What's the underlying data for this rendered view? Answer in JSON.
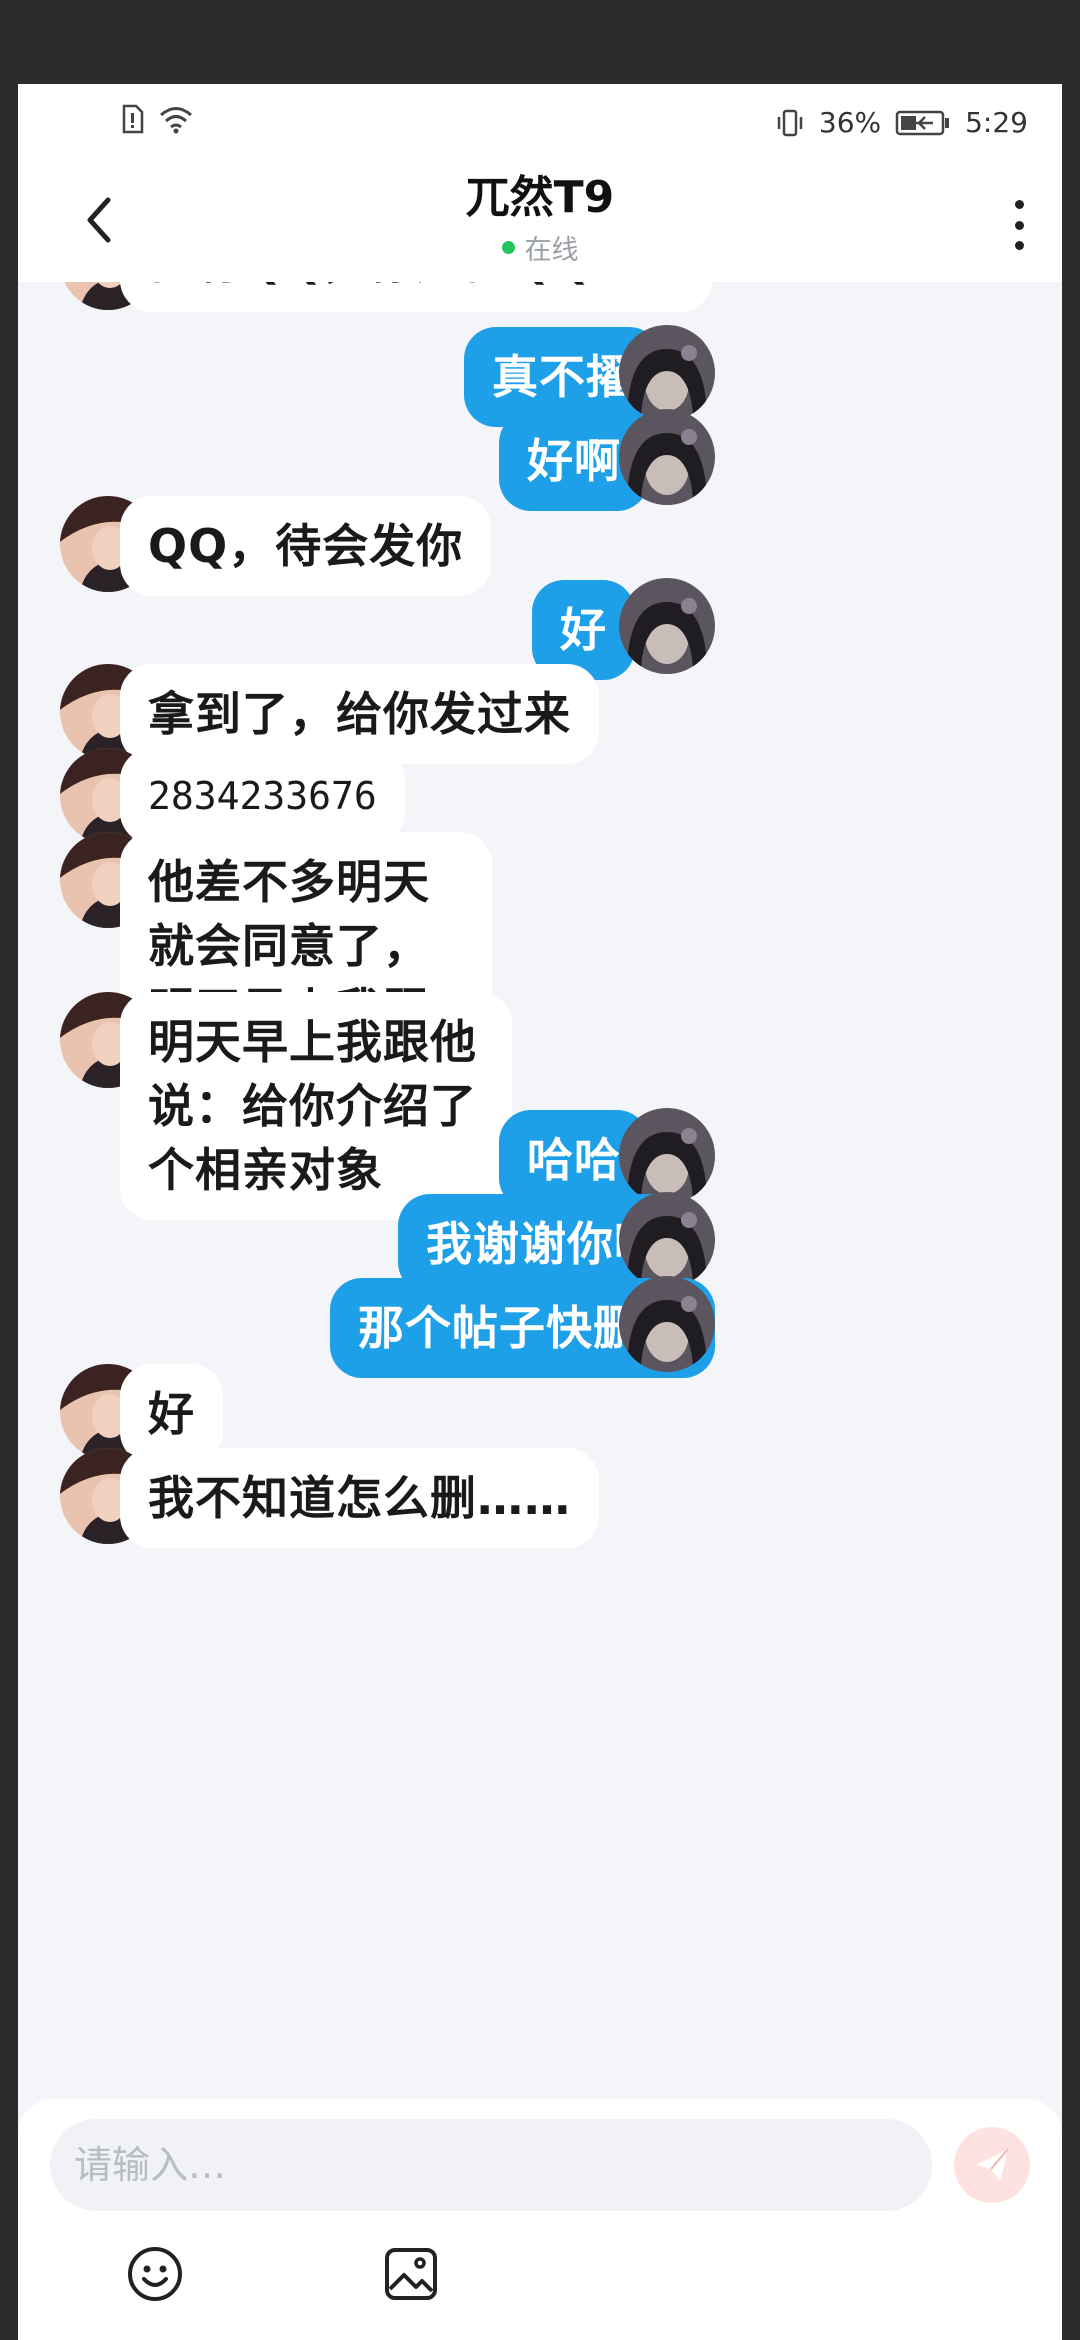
{
  "status_bar": {
    "battery": "36%",
    "time": "5:29"
  },
  "header": {
    "title": "兀然T9",
    "presence": "在线"
  },
  "messages": [
    {
      "side": "left",
      "text": "他有QQ，你加他QQ吧！"
    },
    {
      "side": "right",
      "text": "真不擢"
    },
    {
      "side": "right",
      "text": "好啊"
    },
    {
      "side": "left",
      "text": "QQ，待会发你"
    },
    {
      "side": "right",
      "text": "好"
    },
    {
      "side": "left",
      "text": "拿到了，给你发过来"
    },
    {
      "side": "left",
      "text": "2834233676"
    },
    {
      "side": "left",
      "text": "他差不多明天就会同意了，明天早上我跟他说一下"
    },
    {
      "side": "left",
      "text": "明天早上我跟他说：给你介绍了个相亲对象"
    },
    {
      "side": "right",
      "text": "哈哈"
    },
    {
      "side": "right",
      "text": "我谢谢你啊"
    },
    {
      "side": "right",
      "text": "那个帖子快删了"
    },
    {
      "side": "left",
      "text": "好"
    },
    {
      "side": "left",
      "text": "我不知道怎么删……"
    }
  ],
  "composer": {
    "placeholder": "请输入…"
  },
  "colors": {
    "accent": "#1ea0e8",
    "online": "#22c55e",
    "send_bg": "#fde2df",
    "background": "#f4f5f9"
  },
  "icons": [
    "back-icon",
    "more-icon",
    "emoji-icon",
    "image-icon",
    "send-icon"
  ]
}
